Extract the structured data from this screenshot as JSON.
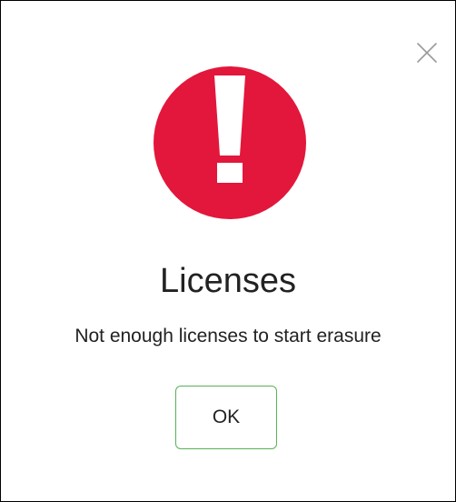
{
  "dialog": {
    "title": "Licenses",
    "message": "Not enough licenses to start erasure",
    "ok_label": "OK",
    "close_icon": "close-icon",
    "alert_icon": "exclamation-circle-icon"
  },
  "colors": {
    "alert_red": "#e2173b",
    "ok_border": "#58b258",
    "close_gray": "#9a9a9a",
    "text": "#222222"
  }
}
